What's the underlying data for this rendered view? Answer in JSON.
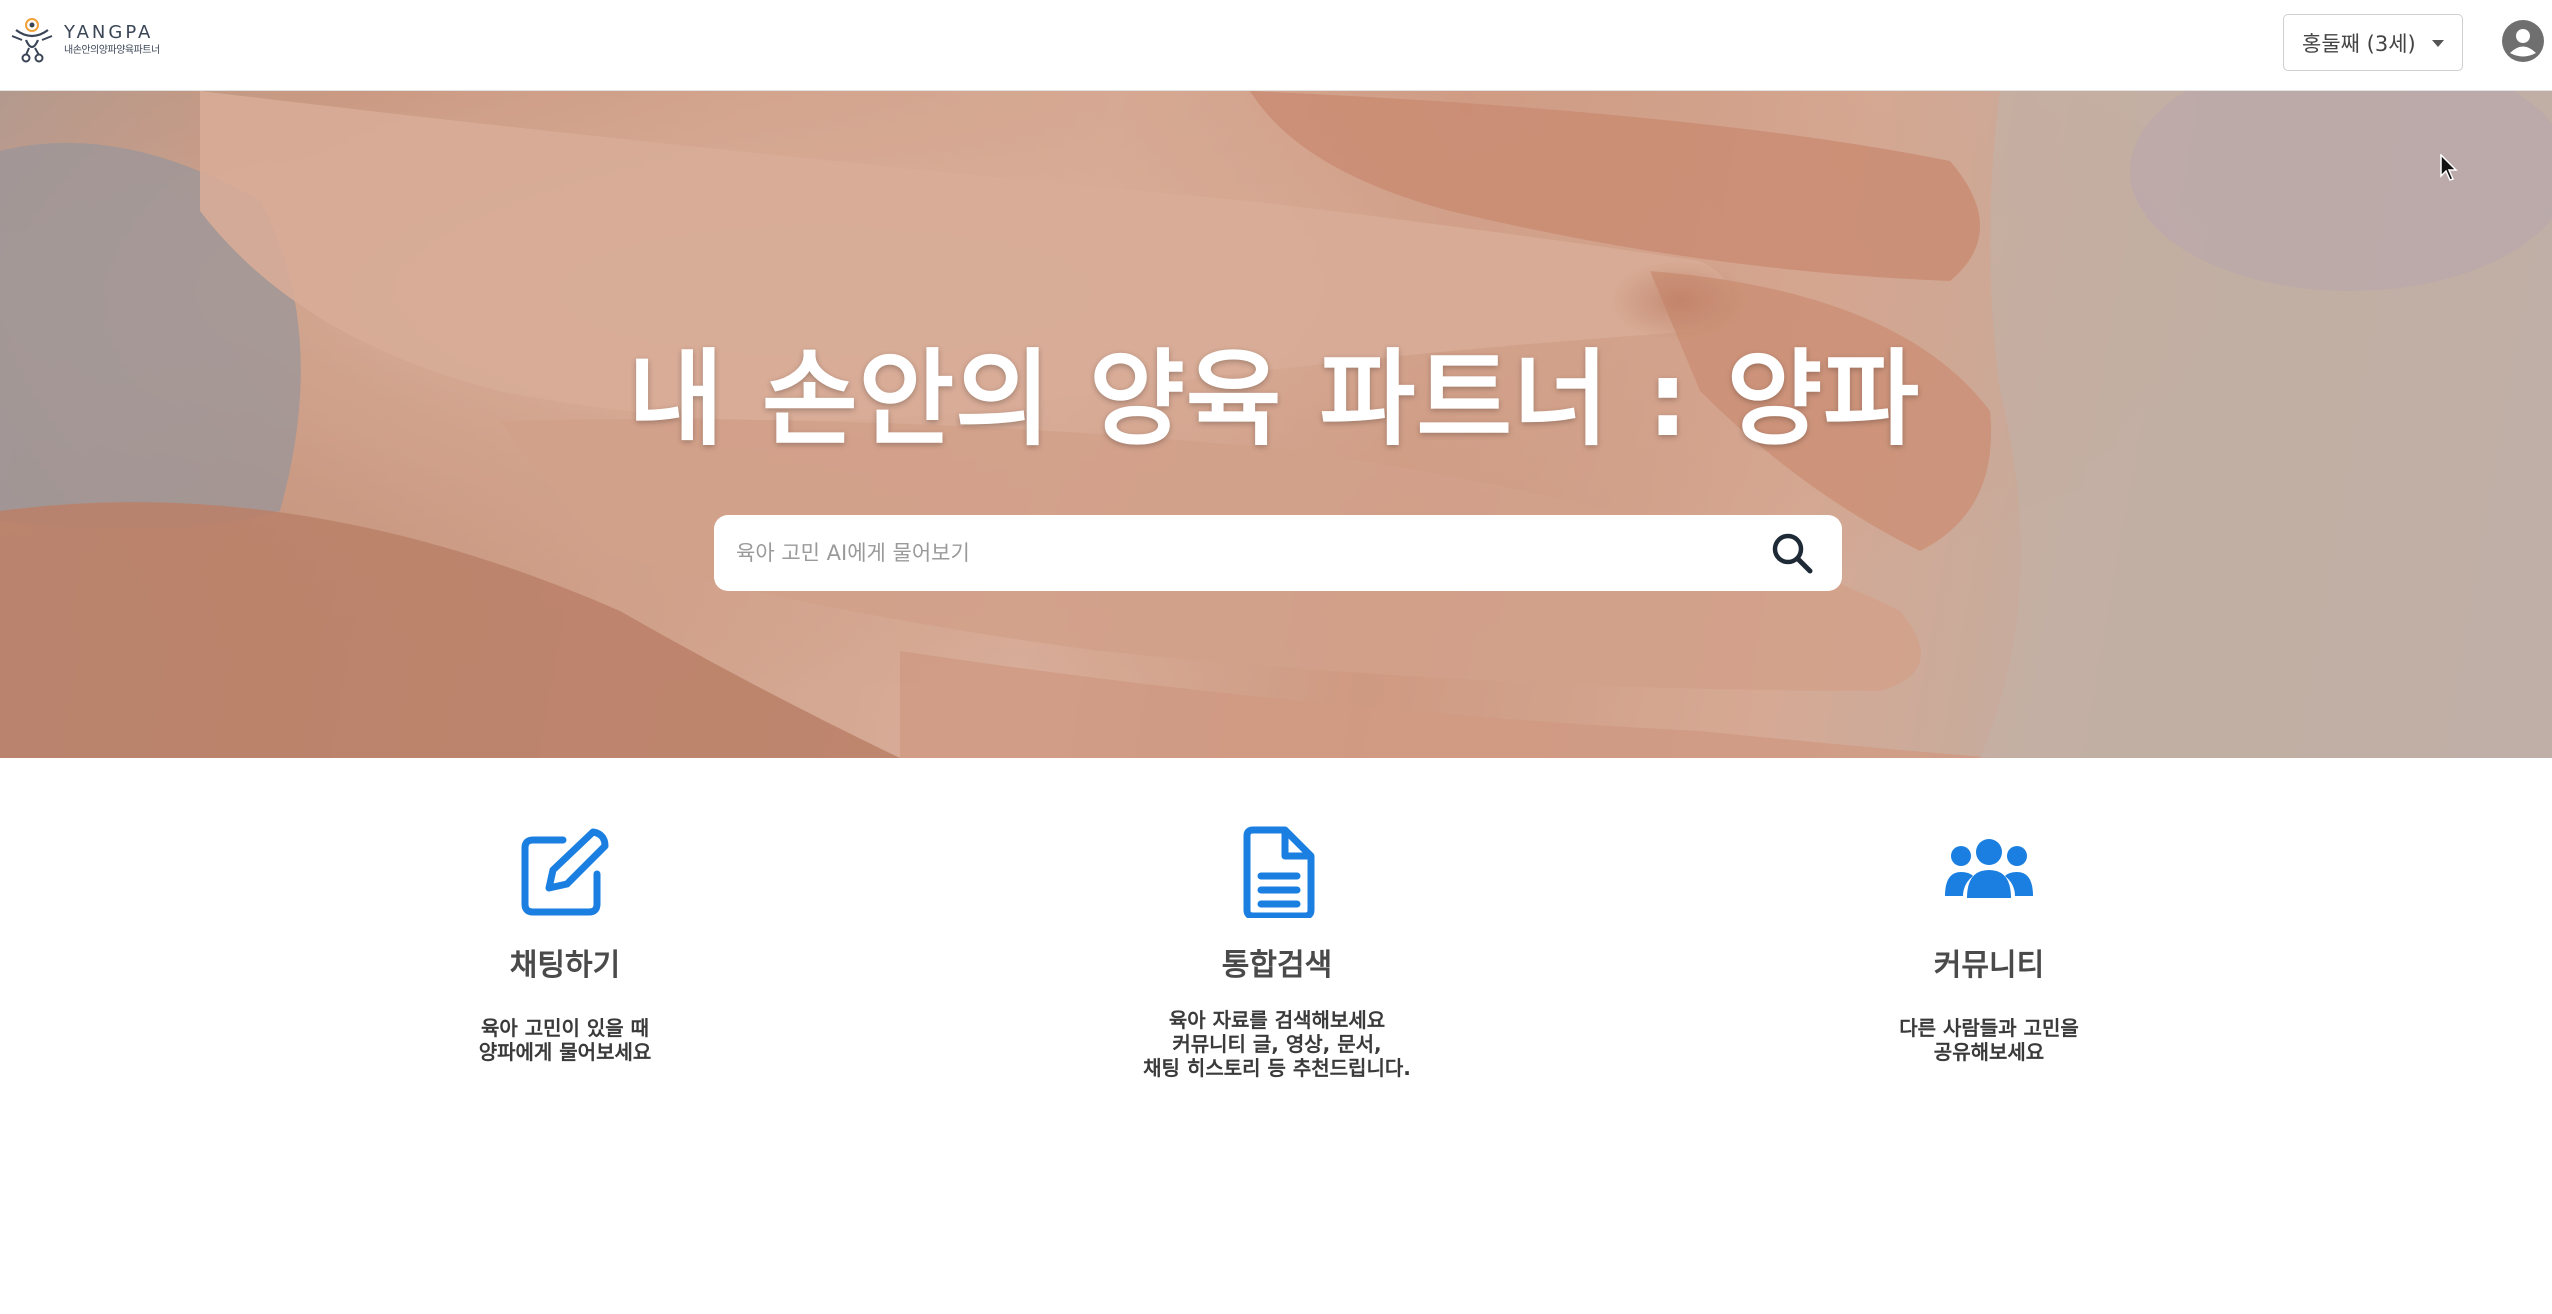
{
  "header": {
    "logo_title": "YANGPA",
    "logo_subtitle": "내손안의양파양육파트너",
    "child_select": "홍둘째 (3세)",
    "avatar_icon": "user-circle-icon"
  },
  "hero": {
    "title": "내 손안의 양육 파트너 : 양파",
    "search_placeholder": "육아 고민 AI에게 물어보기",
    "search_icon": "search-icon"
  },
  "features": [
    {
      "icon": "edit-icon",
      "title": "채팅하기",
      "desc": [
        "육아 고민이 있을 때",
        "양파에게 물어보세요"
      ]
    },
    {
      "icon": "document-icon",
      "title": "통합검색",
      "desc": [
        "육아 자료를 검색해보세요",
        "커뮤니티 글, 영상, 문서,",
        "채팅 히스토리 등 추천드립니다."
      ]
    },
    {
      "icon": "users-icon",
      "title": "커뮤니티",
      "desc": [
        "다른 사람들과 고민을",
        "공유해보세요"
      ]
    }
  ],
  "colors": {
    "accent": "#1a7fe0",
    "title_text": "#4a4a4a"
  }
}
